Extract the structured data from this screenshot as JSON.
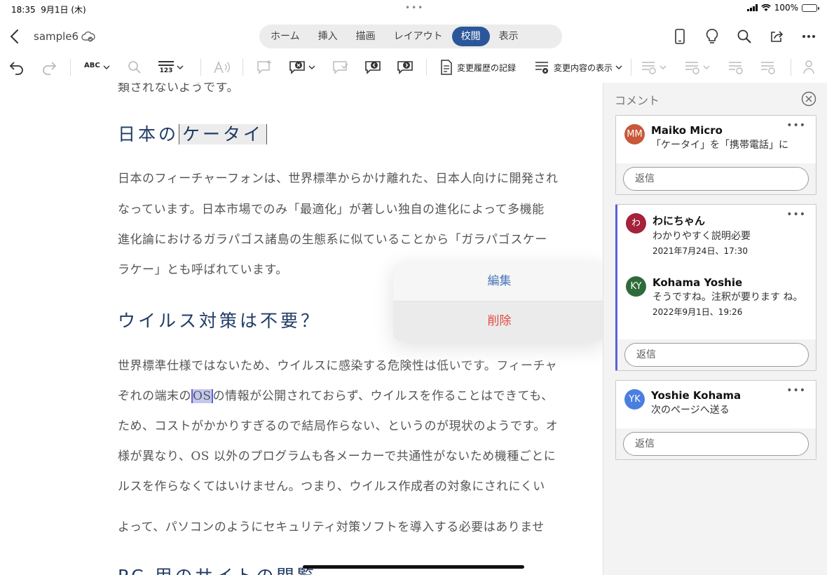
{
  "status": {
    "time": "18:35",
    "date": "9月1日 (木)",
    "battery": "100%"
  },
  "header": {
    "doc_name": "sample6",
    "tabs": [
      {
        "label": "ホーム"
      },
      {
        "label": "挿入"
      },
      {
        "label": "描画"
      },
      {
        "label": "レイアウト"
      },
      {
        "label": "校閲"
      },
      {
        "label": "表示"
      }
    ],
    "active_tab": "校閲"
  },
  "ribbon": {
    "spelling_label": "ABC",
    "wordcount_label": "123",
    "track_changes_label": "変更履歴の記録",
    "show_markup_label": "変更内容の表示"
  },
  "document": {
    "top_cut_line": "類されないようです。",
    "heading1_prefix": "日本の",
    "heading1_highlight": "ケータイ",
    "para1": [
      "日本のフィーチャーフォンは、世界標準からかけ離れた、日本人向けに開発され",
      "なっています。日本市場でのみ「最適化」が著しい独自の進化によって多機能",
      "進化論におけるガラパゴス諸島の生態系に似ていることから「ガラパゴスケー",
      "ラケー」とも呼ばれています。"
    ],
    "heading2": "ウイルス対策は不要？",
    "para2_line1": "世界標準仕様ではないため、ウイルスに感染する危険性は低いです。フィーチャ",
    "para2_line2_pre": "ぞれの端末の",
    "para2_line2_sel": "OS",
    "para2_line2_post": "の情報が公開されておらず、ウイルスを作ることはできても、",
    "para2_rest": [
      "ため、コストがかかりすぎるので結局作らない、というのが現状のようです。オ",
      "様が異なり、OS 以外のプログラムも各メーカーで共通性がないため機種ごとに",
      "ルスを作らなくてはいけません。つまり、ウイルス作成者の対象にされにくい"
    ],
    "para3": "よって、パソコンのようにセキュリティ対策ソフトを導入する必要はありませ",
    "heading3_cut": "PC 用のサイトの閲覧"
  },
  "popover": {
    "edit": "編集",
    "delete": "削除"
  },
  "comments": {
    "title": "コメント",
    "reply_label": "返信",
    "threads": [
      {
        "entries": [
          {
            "initials": "MM",
            "name": "Maiko Micro",
            "text": "「ケータイ」を「携帯電話」に",
            "date": "",
            "color": "#c9573a"
          }
        ]
      },
      {
        "entries": [
          {
            "initials": "わ",
            "name": "わにちゃん",
            "text": "わかりやすく説明必要",
            "date": "2021年7月24日、17:30",
            "color": "#a4223a"
          },
          {
            "initials": "KY",
            "name": "Kohama Yoshie",
            "text": "そうですね。注釈が要ります ね。",
            "date": "2022年9月1日、19:26",
            "color": "#2f6b3a"
          }
        ]
      },
      {
        "entries": [
          {
            "initials": "YK",
            "name": "Yoshie Kohama",
            "text": "次のページへ送る",
            "date": "",
            "color": "#4a7fe0"
          }
        ]
      }
    ]
  },
  "colors": {
    "accent": "#2b579a",
    "selection": "#5c62d6",
    "delete": "#e24a40"
  }
}
